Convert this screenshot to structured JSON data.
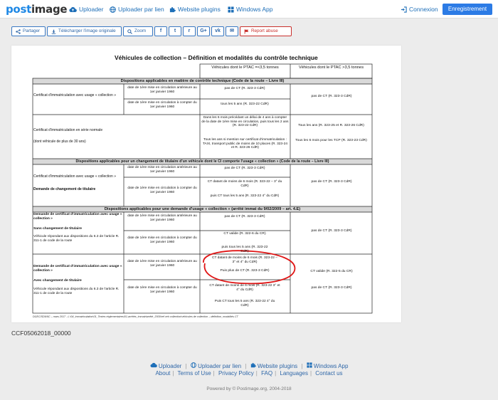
{
  "header": {
    "logo_left": "post",
    "logo_right": "image",
    "nav": [
      {
        "label": "Uploader",
        "icon": "cloud-upload-icon"
      },
      {
        "label": "Uploader par lien",
        "icon": "globe-icon"
      },
      {
        "label": "Website plugins",
        "icon": "puzzle-icon"
      },
      {
        "label": "Windows App",
        "icon": "windows-icon"
      }
    ],
    "login": "Connexion",
    "register": "Enregistrement"
  },
  "toolbar": {
    "share": "Partager",
    "download": "Télécharger l'image originale",
    "zoom": "Zoom",
    "social": [
      "f",
      "t",
      "r",
      "G+",
      "vk",
      "✉"
    ],
    "report": "Report abuse"
  },
  "document": {
    "title": "Véhicules de collection – Définition et modalités du contrôle technique",
    "col_heads": [
      "Véhicules dont le PTAC =<3,5 tonnes",
      "Véhicules dont le PTAC >3,5 tonnes"
    ],
    "sections": [
      "Dispositions applicables en matière de contrôle technique (Code de la route – Livre III)",
      "Dispositions applicables pour un changement de titulaire d'un véhicule dont le CI comporte l'usage « collection » (Code de la route – Livre III)",
      "Dispositions applicables pour une demande d'usage « collection » (arrêté immat du 9/02/2009 – art. 4.E)"
    ],
    "rows": {
      "r1_label": "Certificat d'immatriculation avec usage « collection »",
      "r1_dates": [
        "date de 1ère mise en circulation antérieure au 1er janvier 1960",
        "date de 1ère mise en circulation à compter du 1er janvier 1960"
      ],
      "r1_c1": [
        "pas de CT (R. 323-3 CdR)",
        "tous les 5 ans (R. 323-22 CdR)"
      ],
      "r1_c2": "pas de CT (R. 323-3 CdR)",
      "r2_label": "Certificat d'immatriculation en série normale",
      "r2_label2": "(dont véhicule de plus de 30 ans)",
      "r2_c1": [
        "Dans les 6 mois précédant un délai de 4 ans à compter de la date de 1ère mise en circulation, puis tous les 2 ans (R. 323-22 CdR)",
        "Tous les ans si mention sur certificat d'immatriculation : TAXI, transport public de moins de 10 places (R. 323-24 et R. 323-26 CdR)"
      ],
      "r2_c2": [
        "Tous les ans (R. 323-25 et R. 323-26 CdR)",
        "Tous les 6 mois pour les TCP (R. 323-23 CdR)"
      ],
      "r3_label": "Certificat d'immatriculation avec usage « collection »",
      "r3_label2": "Demande de changement de titulaire",
      "r3_dates": [
        "date de 1ère mise en circulation antérieure au 1er janvier 1960",
        "date de 1ère mise en circulation à compter du 1er janvier 1960"
      ],
      "r3_c1": [
        "pas de CT (R. 323-3 CdR)",
        "CT datant de moins de 6 mois (R. 323-22 – 3° du CdR)",
        "puis CT tous les 5 ans (R. 323-22 4° du CdR)"
      ],
      "r3_c2": "pas de CT (R. 323-3 CdR)",
      "r4_label": "Demande de certificat d'immatriculation avec usage « collection »",
      "r4_label2": "Sans changement de titulaire",
      "r4_label3": "Véhicule répondant aux dispositions du 6.3 de l'article R. 311-1 de code de la route",
      "r4_dates": [
        "date de 1ère mise en circulation antérieure au 1er janvier 1960",
        "date de 1ère mise en circulation à compter du 1er janvier 1960"
      ],
      "r4_c1": [
        "pas de CT (R. 323-3 CdR)",
        "CT valide (R. 322-6 du CR)",
        "puis tous les 5 ans (R. 323-22 CdR)"
      ],
      "r4_c2": "pas de CT (R. 323-3 CdR)",
      "r5_label": "Demande de certificat d'immatriculation avec usage « collection »",
      "r5_label2": "Avec changement de titulaire",
      "r5_label3": "Véhicule répondant aux dispositions du 6.3 de l'article R. 311-1 de code de la route",
      "r5_dates": [
        "date de 1ère mise en circulation antérieure au 1er janvier 1960",
        "date de 1ère mise en circulation à compter du 1er janvier 1960"
      ],
      "r5_c1": [
        "CT datant de moins de 6 mois (R. 323-22 – 3° et 4° du CdR)",
        "Puis plus de CT (R. 323-3 CdR)",
        "CT datant de moins de 6 mois (R. 323-22 3° et 4° du CdR)",
        "Puis CT tous les 5 ans (R. 323-22 4° du CdR)"
      ],
      "r5_c2": [
        "CT valide (R. 322-5 du CR)",
        "pas de CT (R. 323-3 CdR)"
      ]
    },
    "footnote": "DGEC/SD6/6C – mars 2017 - L:\\04_immatriculation\\01_Textes réglementaires\\01-arrêtés_immatriarrêté_2009\\ref veh collection\\véhicules de collection – définition_modalités CT"
  },
  "filename": "CCF05062018_00000",
  "footer": {
    "links1": [
      {
        "label": "Uploader",
        "icon": "cloud-upload-icon"
      },
      {
        "label": "Uploader par lien",
        "icon": "globe-icon"
      },
      {
        "label": "Website plugins",
        "icon": "puzzle-icon"
      },
      {
        "label": "Windows App",
        "icon": "windows-icon"
      }
    ],
    "links2": [
      "About",
      "Terms of Use",
      "Privacy Policy",
      "FAQ",
      "Languages",
      "Contact us"
    ],
    "powered": "Powered by © Postimage.org, 2004-2018"
  },
  "colors": {
    "accent": "#2c7be5",
    "link": "#2f67a8",
    "report": "#c9302c",
    "annotation": "#e01515",
    "section_bg": "#d9d9d9"
  }
}
